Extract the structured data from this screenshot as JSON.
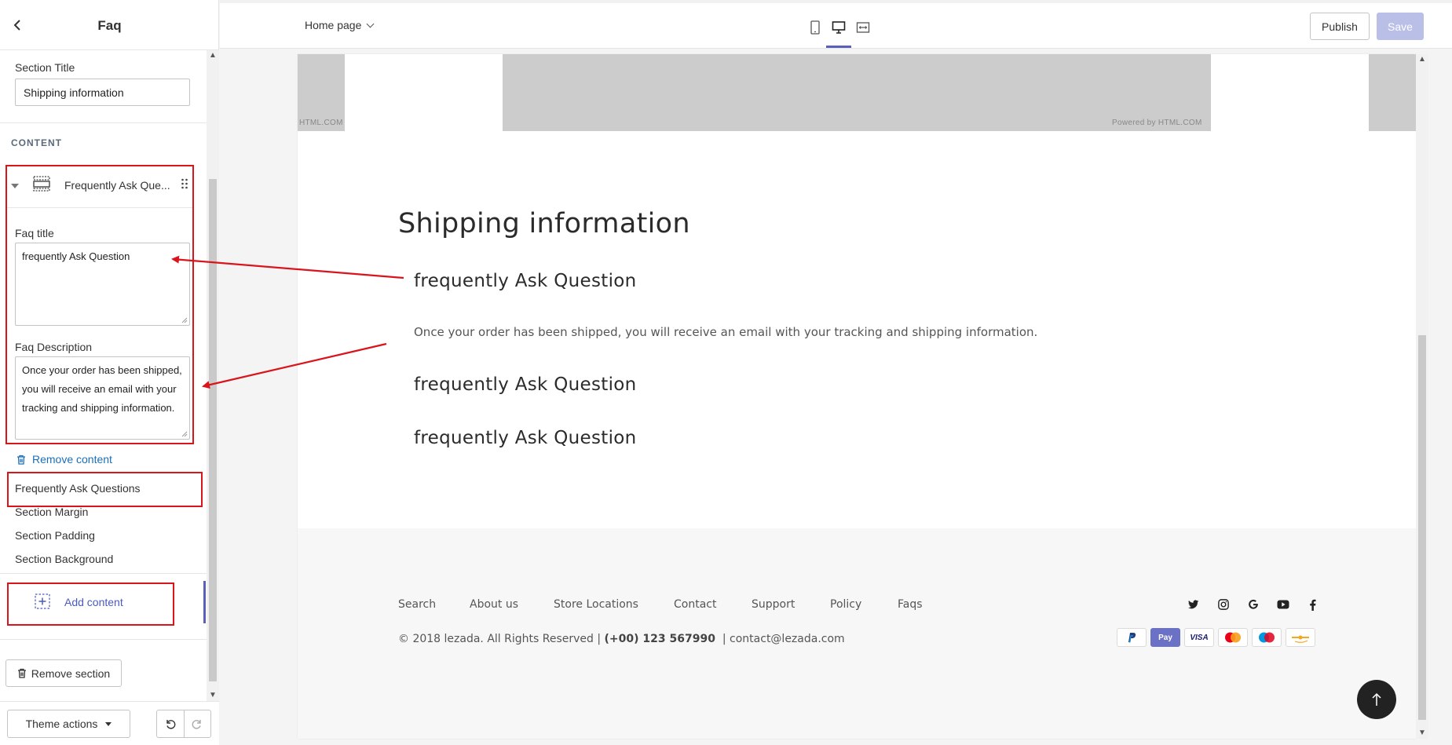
{
  "sidebar": {
    "title": "Faq",
    "section_title_label": "Section Title",
    "section_title_value": "Shipping information",
    "content_heading": "CONTENT",
    "block_name": "Frequently Ask Que...",
    "faq_title_label": "Faq title",
    "faq_title_value": "frequently Ask Question",
    "faq_desc_label": "Faq Description",
    "faq_desc_value": "Once your order has been shipped, you will receive an email with your tracking and shipping information.",
    "remove_content": "Remove content",
    "menu": [
      "Frequently Ask Questions",
      "Section Margin",
      "Section Padding",
      "Section Background"
    ],
    "add_content": "Add content",
    "remove_section": "Remove section",
    "theme_actions": "Theme actions"
  },
  "topbar": {
    "page": "Home page",
    "publish": "Publish",
    "save": "Save"
  },
  "preview": {
    "banner_left_text": "HTML.COM",
    "banner_right_text": "Powered by HTML.COM",
    "section_title": "Shipping information",
    "faqs": [
      {
        "question": "frequently Ask Question",
        "answer": "Once your order has been shipped, you will receive an email with your tracking and shipping information."
      },
      {
        "question": "frequently Ask Question"
      },
      {
        "question": "frequently Ask Question"
      }
    ],
    "footer": {
      "links": [
        "Search",
        "About us",
        "Store Locations",
        "Contact",
        "Support",
        "Policy",
        "Faqs"
      ],
      "copyright_prefix": "© 2018 lezada. All Rights Reserved | ",
      "phone": "(+00) 123 567990",
      "email_suffix": "  | contact@lezada.com",
      "social_icons": [
        "twitter-icon",
        "instagram-icon",
        "google-icon",
        "youtube-icon",
        "facebook-icon"
      ],
      "payment_icons": [
        "paypal-icon",
        "shop-pay-icon",
        "visa-icon",
        "mastercard-icon",
        "maestro-icon",
        "card-icon"
      ],
      "pay_label_shop": "Pay",
      "pay_label_visa": "VISA"
    }
  },
  "colors": {
    "accent": "#5a5fb8",
    "link": "#1b6fb8",
    "annotation": "#d9141b",
    "save_disabled": "#b9bfe6"
  }
}
